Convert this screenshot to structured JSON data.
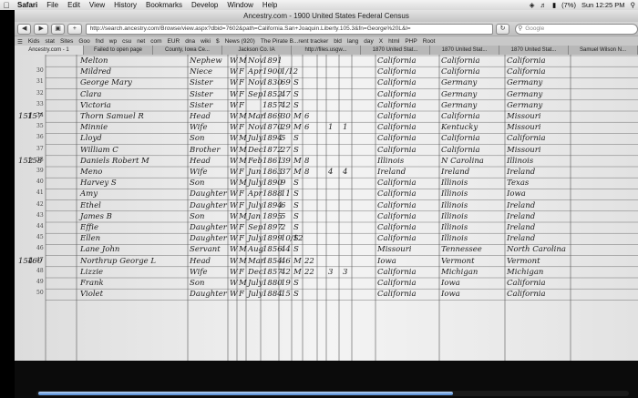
{
  "menubar": {
    "app": "Safari",
    "items": [
      "File",
      "Edit",
      "View",
      "History",
      "Bookmarks",
      "Develop",
      "Window",
      "Help"
    ],
    "battery": "(7%)",
    "clock": "Sun 12:25 PM"
  },
  "window": {
    "title": "Ancestry.com - 1900 United States Federal Census",
    "url": "http://search.ancestry.com/Browse/view.aspx?dbid=7602&path=California.San+Joaquin.Liberty.105.3&fn=George%20L&l=",
    "search_placeholder": "Google"
  },
  "bookmarks": [
    "Kids",
    "stat",
    "Sites",
    "Goo",
    "fnd",
    "wp",
    "csu",
    "net",
    "com",
    "EUR",
    "dna",
    "wiki",
    "$",
    "News (920)",
    "The Pirate B...rent tracker",
    "bld",
    "lang",
    "day",
    "X",
    "html",
    "PHP",
    "Root"
  ],
  "tabs": [
    "Ancestry.com - 1",
    "Failed to open page",
    "County, Iowa Ce...",
    "Jackson Co. IA",
    "http://files.usgw...",
    "1870 United Stat...",
    "1870 United Stat...",
    "1870 United Stat...",
    "Samuel Wilson N..."
  ],
  "census_rows": [
    {
      "line": "",
      "dwell": "",
      "fam": "",
      "name": "Melton",
      "rel": "Nephew",
      "color": "W",
      "sex": "M",
      "month": "Nov",
      "year": "1891",
      "age": "",
      "married": "",
      "col1": "",
      "col2": "",
      "col3": "",
      "birth": "California",
      "father": "California",
      "mother": "California"
    },
    {
      "line": "30",
      "dwell": "",
      "fam": "",
      "name": "Mildred",
      "rel": "Niece",
      "color": "W",
      "sex": "F",
      "month": "Apr",
      "year": "1900",
      "age": "1/12",
      "married": "",
      "col1": "",
      "col2": "",
      "col3": "",
      "birth": "California",
      "father": "California",
      "mother": "California"
    },
    {
      "line": "31",
      "dwell": "",
      "fam": "",
      "name": "George Mary",
      "rel": "Sister",
      "color": "W",
      "sex": "F",
      "month": "Nov",
      "year": "1830",
      "age": "69",
      "married": "S",
      "col1": "",
      "col2": "",
      "col3": "",
      "birth": "California",
      "father": "Germany",
      "mother": "Germany"
    },
    {
      "line": "32",
      "dwell": "",
      "fam": "",
      "name": "Clara",
      "rel": "Sister",
      "color": "W",
      "sex": "F",
      "month": "Sep",
      "year": "1852",
      "age": "47",
      "married": "S",
      "col1": "",
      "col2": "",
      "col3": "",
      "birth": "California",
      "father": "Germany",
      "mother": "Germany"
    },
    {
      "line": "33",
      "dwell": "",
      "fam": "",
      "name": "Victoria",
      "rel": "Sister",
      "color": "W",
      "sex": "F",
      "month": "",
      "year": "1857",
      "age": "42",
      "married": "S",
      "col1": "",
      "col2": "",
      "col3": "",
      "birth": "California",
      "father": "Germany",
      "mother": "Germany"
    },
    {
      "line": "34",
      "dwell": "151",
      "fam": "157",
      "name": "Thorn Samuel R",
      "rel": "Head",
      "color": "W",
      "sex": "M",
      "month": "Mar",
      "year": "1869",
      "age": "30",
      "married": "M",
      "col1": "6",
      "col2": "",
      "col3": "",
      "birth": "California",
      "father": "California",
      "mother": "Missouri"
    },
    {
      "line": "35",
      "dwell": "",
      "fam": "",
      "name": "Minnie",
      "rel": "Wife",
      "color": "W",
      "sex": "F",
      "month": "Nov",
      "year": "1870",
      "age": "29",
      "married": "M",
      "col1": "6",
      "col2": "1",
      "col3": "1",
      "birth": "California",
      "father": "Kentucky",
      "mother": "Missouri"
    },
    {
      "line": "36",
      "dwell": "",
      "fam": "",
      "name": "Lloyd",
      "rel": "Son",
      "color": "W",
      "sex": "M",
      "month": "July",
      "year": "1894",
      "age": "5",
      "married": "S",
      "col1": "",
      "col2": "",
      "col3": "",
      "birth": "California",
      "father": "California",
      "mother": "California"
    },
    {
      "line": "37",
      "dwell": "",
      "fam": "",
      "name": "William C",
      "rel": "Brother",
      "color": "W",
      "sex": "M",
      "month": "Dec",
      "year": "1872",
      "age": "27",
      "married": "S",
      "col1": "",
      "col2": "",
      "col3": "",
      "birth": "California",
      "father": "California",
      "mother": "Missouri"
    },
    {
      "line": "38",
      "dwell": "152",
      "fam": "158",
      "name": "Daniels Robert M",
      "rel": "Head",
      "color": "W",
      "sex": "M",
      "month": "Feb",
      "year": "1861",
      "age": "39",
      "married": "M",
      "col1": "8",
      "col2": "",
      "col3": "",
      "birth": "Illinois",
      "father": "N Carolina",
      "mother": "Illinois"
    },
    {
      "line": "39",
      "dwell": "",
      "fam": "",
      "name": "Meno",
      "rel": "Wife",
      "color": "W",
      "sex": "F",
      "month": "Jun",
      "year": "1863",
      "age": "37",
      "married": "M",
      "col1": "8",
      "col2": "4",
      "col3": "4",
      "birth": "Ireland",
      "father": "Ireland",
      "mother": "Ireland"
    },
    {
      "line": "40",
      "dwell": "",
      "fam": "",
      "name": "Harvey S",
      "rel": "Son",
      "color": "W",
      "sex": "M",
      "month": "July",
      "year": "1890",
      "age": "9",
      "married": "S",
      "col1": "",
      "col2": "",
      "col3": "",
      "birth": "California",
      "father": "Illinois",
      "mother": "Texas"
    },
    {
      "line": "41",
      "dwell": "",
      "fam": "",
      "name": "Amy",
      "rel": "Daughter",
      "color": "W",
      "sex": "F",
      "month": "Apr",
      "year": "1888",
      "age": "11",
      "married": "S",
      "col1": "",
      "col2": "",
      "col3": "",
      "birth": "California",
      "father": "Illinois",
      "mother": "Iowa"
    },
    {
      "line": "42",
      "dwell": "",
      "fam": "",
      "name": "Ethel",
      "rel": "Daughter",
      "color": "W",
      "sex": "F",
      "month": "July",
      "year": "1894",
      "age": "6",
      "married": "S",
      "col1": "",
      "col2": "",
      "col3": "",
      "birth": "California",
      "father": "Illinois",
      "mother": "Ireland"
    },
    {
      "line": "43",
      "dwell": "",
      "fam": "",
      "name": "James B",
      "rel": "Son",
      "color": "W",
      "sex": "M",
      "month": "Jan",
      "year": "1895",
      "age": "5",
      "married": "S",
      "col1": "",
      "col2": "",
      "col3": "",
      "birth": "California",
      "father": "Illinois",
      "mother": "Ireland"
    },
    {
      "line": "44",
      "dwell": "",
      "fam": "",
      "name": "Effie",
      "rel": "Daughter",
      "color": "W",
      "sex": "F",
      "month": "Sep",
      "year": "1897",
      "age": "2",
      "married": "S",
      "col1": "",
      "col2": "",
      "col3": "",
      "birth": "California",
      "father": "Illinois",
      "mother": "Ireland"
    },
    {
      "line": "45",
      "dwell": "",
      "fam": "",
      "name": "Ellen",
      "rel": "Daughter",
      "color": "W",
      "sex": "F",
      "month": "July",
      "year": "1899",
      "age": "10/12",
      "married": "S",
      "col1": "",
      "col2": "",
      "col3": "",
      "birth": "California",
      "father": "Illinois",
      "mother": "Ireland"
    },
    {
      "line": "46",
      "dwell": "",
      "fam": "",
      "name": "Lane John",
      "rel": "Servant",
      "color": "W",
      "sex": "M",
      "month": "Aug",
      "year": "1856",
      "age": "44",
      "married": "S",
      "col1": "",
      "col2": "",
      "col3": "",
      "birth": "Missouri",
      "father": "Tennessee",
      "mother": "North Carolina"
    },
    {
      "line": "47",
      "dwell": "154",
      "fam": "160",
      "name": "Northrup George L",
      "rel": "Head",
      "color": "W",
      "sex": "M",
      "month": "Mar",
      "year": "1854",
      "age": "46",
      "married": "M",
      "col1": "22",
      "col2": "",
      "col3": "",
      "birth": "Iowa",
      "father": "Vermont",
      "mother": "Vermont"
    },
    {
      "line": "48",
      "dwell": "",
      "fam": "",
      "name": "Lizzie",
      "rel": "Wife",
      "color": "W",
      "sex": "F",
      "month": "Dec",
      "year": "1857",
      "age": "42",
      "married": "M",
      "col1": "22",
      "col2": "3",
      "col3": "3",
      "birth": "California",
      "father": "Michigan",
      "mother": "Michigan"
    },
    {
      "line": "49",
      "dwell": "",
      "fam": "",
      "name": "Frank",
      "rel": "Son",
      "color": "W",
      "sex": "M",
      "month": "July",
      "year": "1880",
      "age": "19",
      "married": "S",
      "col1": "",
      "col2": "",
      "col3": "",
      "birth": "California",
      "father": "Iowa",
      "mother": "California"
    },
    {
      "line": "50",
      "dwell": "",
      "fam": "",
      "name": "Violet",
      "rel": "Daughter",
      "color": "W",
      "sex": "F",
      "month": "July",
      "year": "1884",
      "age": "15",
      "married": "S",
      "col1": "",
      "col2": "",
      "col3": "",
      "birth": "California",
      "father": "Iowa",
      "mother": "California"
    }
  ],
  "scrollbar": {
    "position": 0.7
  }
}
